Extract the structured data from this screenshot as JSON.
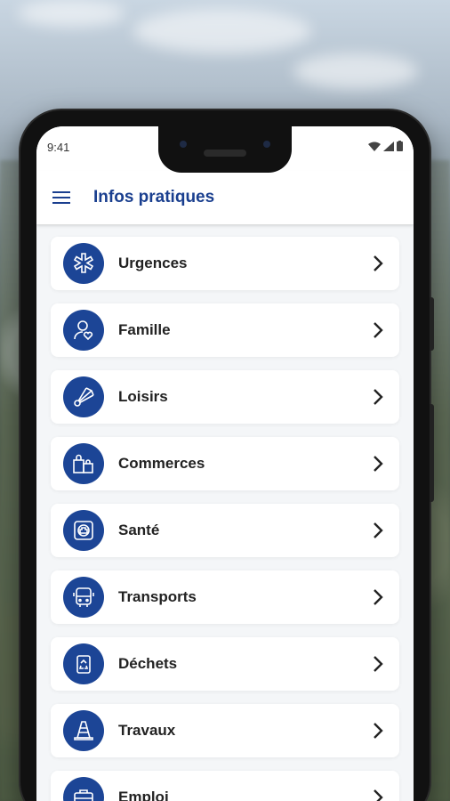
{
  "status": {
    "time": "9:41"
  },
  "app_bar": {
    "title": "Infos pratiques",
    "menu_icon": "menu-icon"
  },
  "colors": {
    "primary": "#1c4596",
    "title": "#1a3f8f",
    "background": "#f4f6f8"
  },
  "items": [
    {
      "label": "Urgences",
      "icon": "emergency-star-icon"
    },
    {
      "label": "Famille",
      "icon": "family-person-heart-icon"
    },
    {
      "label": "Loisirs",
      "icon": "shuttlecock-icon"
    },
    {
      "label": "Commerces",
      "icon": "shopping-bags-icon"
    },
    {
      "label": "Santé",
      "icon": "health-cross-icon"
    },
    {
      "label": "Transports",
      "icon": "bus-icon"
    },
    {
      "label": "Déchets",
      "icon": "recycle-bin-icon"
    },
    {
      "label": "Travaux",
      "icon": "traffic-cone-icon"
    },
    {
      "label": "Emploi",
      "icon": "briefcase-icon"
    }
  ]
}
